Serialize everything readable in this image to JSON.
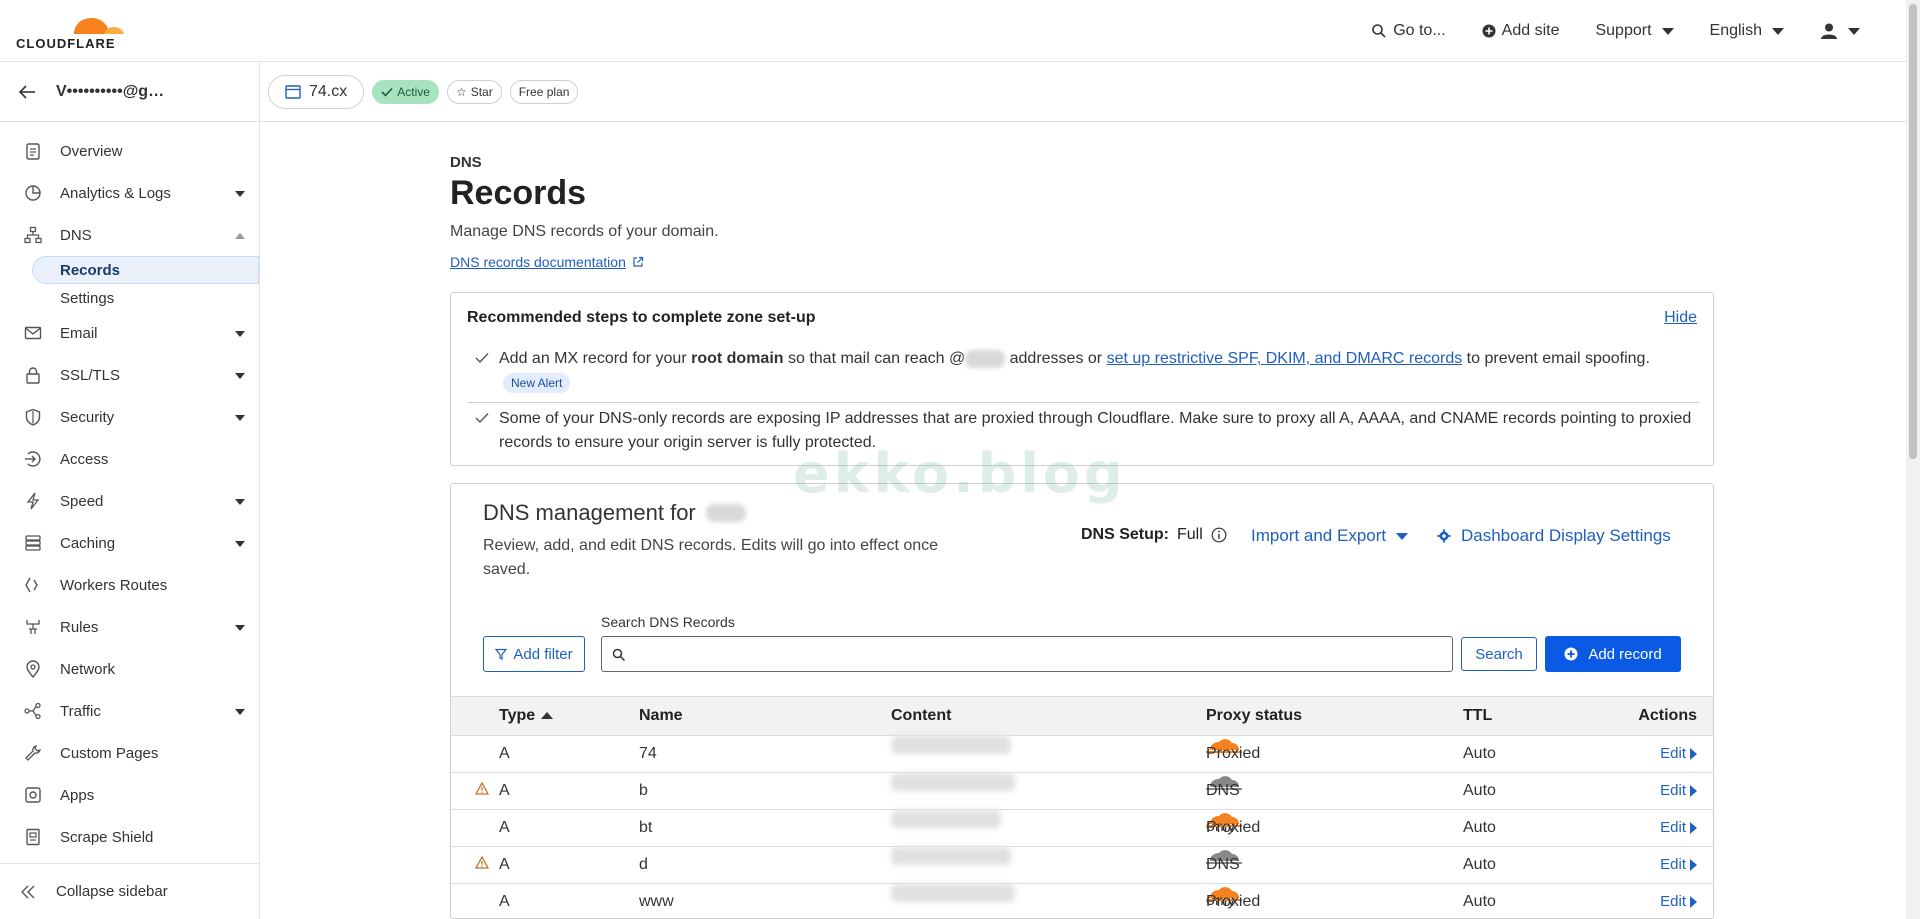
{
  "header": {
    "logo_text": "CLOUDFLARE",
    "goto": "Go to...",
    "add_site": "Add site",
    "support": "Support",
    "language": "English"
  },
  "sidebar": {
    "account_name": "V••••••••••@g…",
    "items": [
      {
        "label": "Overview",
        "icon": "clipboard-icon"
      },
      {
        "label": "Analytics & Logs",
        "icon": "chart-icon",
        "caret": true
      },
      {
        "label": "DNS",
        "icon": "network-icon",
        "expanded": true
      },
      {
        "label": "Email",
        "icon": "mail-icon",
        "caret": true
      },
      {
        "label": "SSL/TLS",
        "icon": "lock-icon",
        "caret": true
      },
      {
        "label": "Security",
        "icon": "shield-icon",
        "caret": true
      },
      {
        "label": "Access",
        "icon": "access-icon"
      },
      {
        "label": "Speed",
        "icon": "bolt-icon",
        "caret": true
      },
      {
        "label": "Caching",
        "icon": "database-icon",
        "caret": true
      },
      {
        "label": "Workers Routes",
        "icon": "workers-icon"
      },
      {
        "label": "Rules",
        "icon": "rules-icon",
        "caret": true
      },
      {
        "label": "Network",
        "icon": "pin-icon"
      },
      {
        "label": "Traffic",
        "icon": "traffic-icon",
        "caret": true
      },
      {
        "label": "Custom Pages",
        "icon": "wrench-icon"
      },
      {
        "label": "Apps",
        "icon": "apps-icon"
      },
      {
        "label": "Scrape Shield",
        "icon": "scrape-icon"
      }
    ],
    "dns_sub": [
      "Records",
      "Settings"
    ],
    "collapse": "Collapse sidebar"
  },
  "zonebar": {
    "domain": "74.cx",
    "status": "Active",
    "star": "Star",
    "plan": "Free plan"
  },
  "page": {
    "crumb": "DNS",
    "title": "Records",
    "subtitle": "Manage DNS records of your domain.",
    "doc_link": "DNS records documentation"
  },
  "steps": {
    "title": "Recommended steps to complete zone set-up",
    "hide": "Hide",
    "step1_a": "Add an MX record for your ",
    "step1_b": "root domain",
    "step1_c": " so that mail can reach @",
    "step1_d": " addresses or ",
    "step1_link": "set up restrictive SPF, DKIM, and DMARC records",
    "step1_e": " to prevent email spoofing.",
    "step1_badge": "New Alert",
    "step2": "Some of your DNS-only records are exposing IP addresses that are proxied through Cloudflare. Make sure to proxy all A, AAAA, and CNAME records pointing to proxied records to ensure your origin server is fully protected."
  },
  "dns": {
    "title": "DNS management for",
    "desc": "Review, add, and edit DNS records. Edits will go into effect once saved.",
    "setup_label": "DNS Setup:",
    "setup_value": "Full",
    "import_export": "Import and Export",
    "display_settings": "Dashboard Display Settings",
    "search_label": "Search DNS Records",
    "search_value": "",
    "add_filter": "Add filter",
    "search_button": "Search",
    "add_record": "Add record",
    "columns": [
      "Type",
      "Name",
      "Content",
      "Proxy status",
      "TTL",
      "Actions"
    ],
    "rows": [
      {
        "warn": false,
        "type": "A",
        "name": "74",
        "proxy": "Proxied",
        "ttl": "Auto",
        "action": "Edit"
      },
      {
        "warn": true,
        "type": "A",
        "name": "b",
        "proxy": "DNS only",
        "ttl": "Auto",
        "action": "Edit"
      },
      {
        "warn": false,
        "type": "A",
        "name": "bt",
        "proxy": "Proxied",
        "ttl": "Auto",
        "action": "Edit"
      },
      {
        "warn": true,
        "type": "A",
        "name": "d",
        "proxy": "DNS only",
        "ttl": "Auto",
        "action": "Edit"
      },
      {
        "warn": false,
        "type": "A",
        "name": "www",
        "proxy": "Proxied",
        "ttl": "Auto",
        "action": "Edit"
      }
    ]
  },
  "colors": {
    "accent": "#0a5ae6",
    "link": "#1f5fbf",
    "proxied": "#f6821f",
    "dns_only": "#888888",
    "active_green": "#a7e3bf"
  },
  "watermark": "ekko.blog"
}
